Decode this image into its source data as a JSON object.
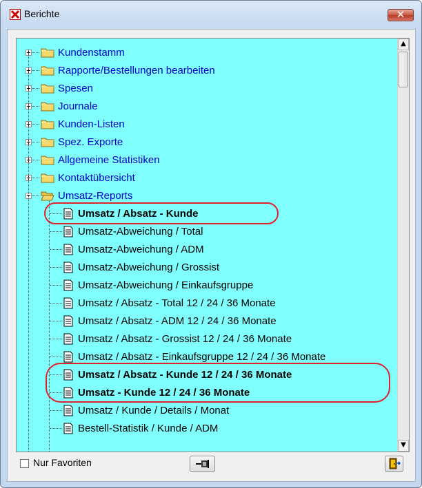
{
  "window": {
    "title": "Berichte",
    "close_label": "✕"
  },
  "tree": {
    "folders": [
      {
        "label": "Kundenstamm",
        "expanded": false
      },
      {
        "label": "Rapporte/Bestellungen bearbeiten",
        "expanded": false
      },
      {
        "label": "Spesen",
        "expanded": false
      },
      {
        "label": "Journale",
        "expanded": false
      },
      {
        "label": "Kunden-Listen",
        "expanded": false
      },
      {
        "label": "Spez. Exporte",
        "expanded": false
      },
      {
        "label": "Allgemeine Statistiken",
        "expanded": false
      },
      {
        "label": "Kontaktübersicht",
        "expanded": false
      },
      {
        "label": "Umsatz-Reports",
        "expanded": true
      }
    ],
    "reports": [
      {
        "label": "Umsatz / Absatz - Kunde",
        "bold": true,
        "highlighted": true
      },
      {
        "label": "Umsatz-Abweichung / Total",
        "bold": false
      },
      {
        "label": "Umsatz-Abweichung / ADM",
        "bold": false
      },
      {
        "label": "Umsatz-Abweichung / Grossist",
        "bold": false
      },
      {
        "label": "Umsatz-Abweichung / Einkaufsgruppe",
        "bold": false
      },
      {
        "label": "Umsatz / Absatz - Total 12 / 24 / 36 Monate",
        "bold": false
      },
      {
        "label": "Umsatz / Absatz - ADM 12 / 24 / 36 Monate",
        "bold": false
      },
      {
        "label": "Umsatz / Absatz - Grossist 12 / 24 / 36 Monate",
        "bold": false
      },
      {
        "label": "Umsatz / Absatz - Einkaufsgruppe 12 / 24 / 36 Monate",
        "bold": false
      },
      {
        "label": "Umsatz / Absatz - Kunde 12 / 24 / 36 Monate",
        "bold": true,
        "highlighted": true
      },
      {
        "label": "Umsatz - Kunde 12 / 24 / 36 Monate",
        "bold": true,
        "highlighted": true
      },
      {
        "label": "Umsatz / Kunde / Details / Monat",
        "bold": false
      },
      {
        "label": "Bestell-Statistik / Kunde / ADM",
        "bold": false
      }
    ]
  },
  "footer": {
    "favorites_label": "Nur Favoriten",
    "favorites_checked": false
  },
  "colors": {
    "tree_background": "#80ffff",
    "folder_text": "#0000cc",
    "highlight_ring": "#e0202a",
    "close_button": "#c9563f"
  },
  "icons": {
    "app": "red-x-icon",
    "folder": "folder-icon",
    "report": "document-icon",
    "pin": "pin-icon",
    "exit": "exit-door-icon"
  }
}
